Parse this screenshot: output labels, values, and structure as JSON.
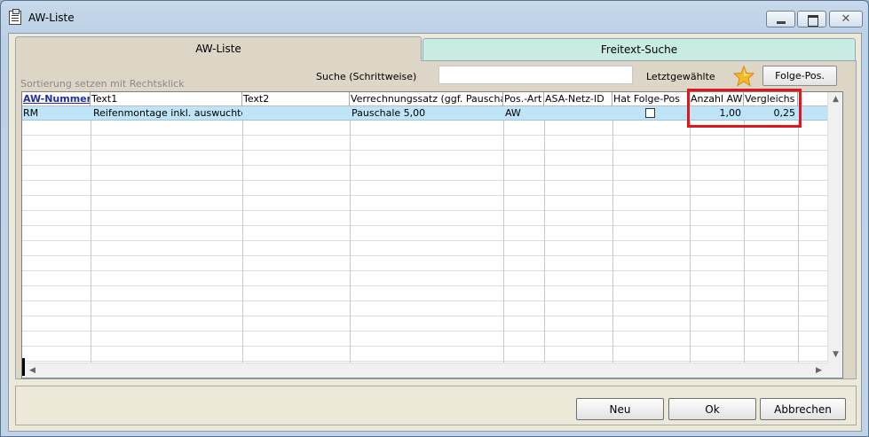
{
  "window": {
    "title": "AW-Liste",
    "close_glyph": "✕"
  },
  "tabs": [
    {
      "label": "AW-Liste",
      "active": true
    },
    {
      "label": "Freitext-Suche",
      "active": false
    }
  ],
  "toolbar": {
    "hint": "Sortierung setzen mit Rechtsklick",
    "search_label": "Suche (Schrittweise)",
    "search_value": "",
    "last_label": "Letztgewählte",
    "star_icon": "star-icon",
    "folge_button": "Folge-Pos."
  },
  "grid": {
    "columns": [
      {
        "label": "AW-Nummer",
        "sorted": true
      },
      {
        "label": "Text1"
      },
      {
        "label": "Text2"
      },
      {
        "label": "Verrechnungssatz (ggf. Pauschale)"
      },
      {
        "label": "Pos.-Art"
      },
      {
        "label": "ASA-Netz-ID"
      },
      {
        "label": "Hat Folge-Pos"
      },
      {
        "label": "Anzahl AW"
      },
      {
        "label": "Vergleichs"
      }
    ],
    "rows": [
      {
        "aw_nummer": "RM",
        "text1": "Reifenmontage inkl. auswuchten",
        "text2": "",
        "verrechnungssatz": "Pauschale 5,00",
        "pos_art": "AW",
        "asa_netz_id": "",
        "hat_folge_pos": false,
        "anzahl_aw": "1,00",
        "vergleich": "0,25"
      }
    ]
  },
  "buttons": {
    "neu": "Neu",
    "ok": "Ok",
    "abbrechen": "Abbrechen"
  },
  "colors": {
    "selected_row": "#bfe3f7",
    "highlight_box": "#e0161d",
    "sorted_header": "#1f2fa8"
  }
}
